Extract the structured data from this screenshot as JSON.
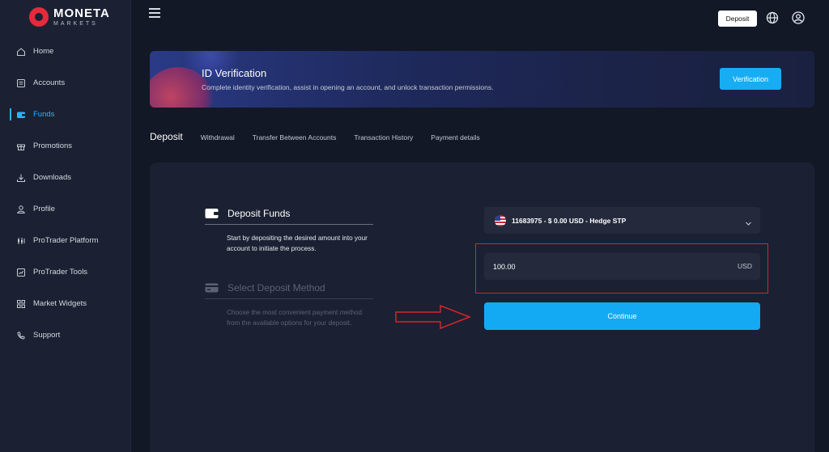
{
  "brand": {
    "name": "MONETA",
    "sub": "MARKETS"
  },
  "sidebar": {
    "items": [
      {
        "label": "Home",
        "icon": "home-icon"
      },
      {
        "label": "Accounts",
        "icon": "accounts-icon"
      },
      {
        "label": "Funds",
        "icon": "wallet-icon",
        "active": true
      },
      {
        "label": "Promotions",
        "icon": "gift-icon"
      },
      {
        "label": "Downloads",
        "icon": "download-icon"
      },
      {
        "label": "Profile",
        "icon": "user-icon"
      },
      {
        "label": "ProTrader Platform",
        "icon": "platform-icon"
      },
      {
        "label": "ProTrader Tools",
        "icon": "chart-icon"
      },
      {
        "label": "Market Widgets",
        "icon": "grid-icon"
      },
      {
        "label": "Support",
        "icon": "phone-icon"
      }
    ]
  },
  "topbar": {
    "deposit_label": "Deposit"
  },
  "banner": {
    "title": "ID Verification",
    "description": "Complete identity verification, assist in opening an account, and unlock transaction permissions.",
    "button_label": "Verification"
  },
  "tabs": [
    {
      "label": "Deposit",
      "active": true
    },
    {
      "label": "Withdrawal"
    },
    {
      "label": "Transfer Between Accounts"
    },
    {
      "label": "Transaction History"
    },
    {
      "label": "Payment details"
    }
  ],
  "steps": [
    {
      "title": "Deposit Funds",
      "description": "Start by depositing the desired amount into your account to initiate the process."
    },
    {
      "title": "Select Deposit Method",
      "description": "Choose the most convenient payment method from the available options for your deposit."
    }
  ],
  "form": {
    "account": "11683975 - $ 0.00 USD - Hedge STP",
    "amount": "100.00",
    "currency": "USD",
    "continue_label": "Continue"
  },
  "colors": {
    "accent": "#13aaf3",
    "annotation": "#d8232a",
    "background": "#131827",
    "panel": "#1b2132"
  }
}
